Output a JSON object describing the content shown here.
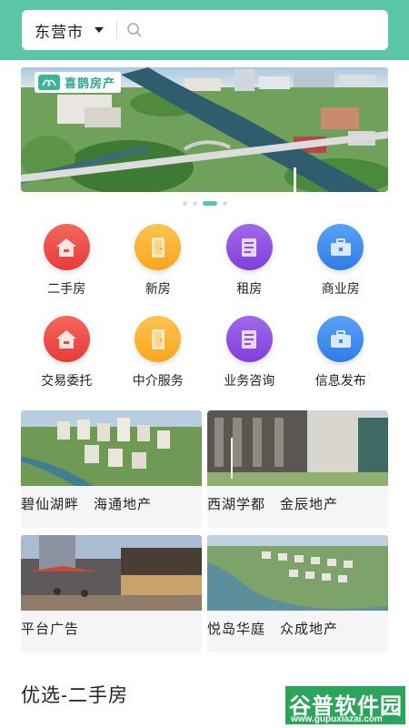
{
  "header": {
    "city": "东营市",
    "search_placeholder": ""
  },
  "banner": {
    "logo_text": "喜鹊房产",
    "slide_count": 4,
    "active_slide": 3
  },
  "categories": [
    {
      "label": "二手房",
      "icon": "house-icon",
      "color": "#ef4b45"
    },
    {
      "label": "新房",
      "icon": "door-icon",
      "color": "#fbb232"
    },
    {
      "label": "租房",
      "icon": "document-icon",
      "color": "#8d52e0"
    },
    {
      "label": "商业房",
      "icon": "briefcase-icon",
      "color": "#3c8cf0"
    },
    {
      "label": "交易委托",
      "icon": "house-icon",
      "color": "#ef4b45"
    },
    {
      "label": "中介服务",
      "icon": "door-icon",
      "color": "#fbb232"
    },
    {
      "label": "业务咨询",
      "icon": "document-icon",
      "color": "#8d52e0"
    },
    {
      "label": "信息发布",
      "icon": "briefcase-icon",
      "color": "#3c8cf0"
    }
  ],
  "cards": [
    {
      "title": "碧仙湖畔　海通地产"
    },
    {
      "title": "西湖学都　金辰地产"
    },
    {
      "title": "平台广告"
    },
    {
      "title": "悦岛华庭　众成地产"
    }
  ],
  "section": {
    "title": "优选-二手房"
  },
  "watermark": {
    "main": "谷普软件园",
    "sub": "www.gupuxiazai.com"
  },
  "colors": {
    "accent": "#5cc6a8"
  }
}
